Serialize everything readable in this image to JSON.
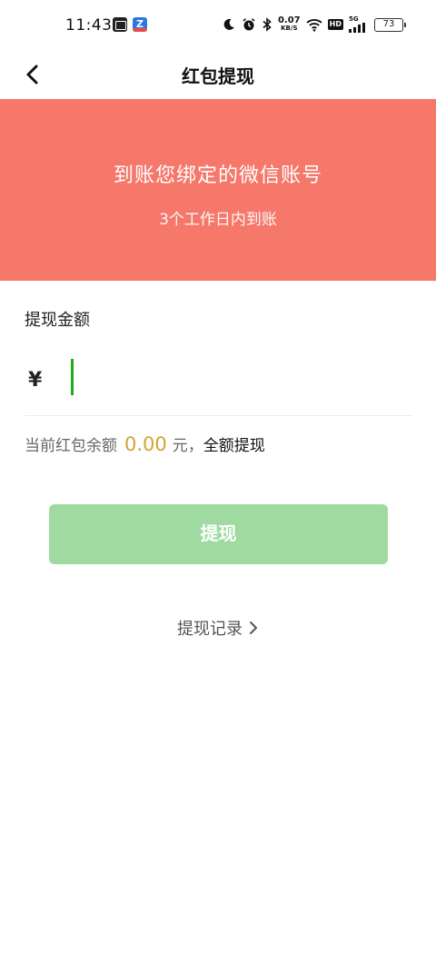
{
  "status_bar": {
    "time": "11:43",
    "app_icon_b_letter": "Z",
    "net_speed_value": "0.07",
    "net_speed_unit": "KB/S",
    "hd_label": "HD",
    "signal_label": "5G",
    "battery_level": "73",
    "icons": [
      "moon-icon",
      "alarm-icon",
      "bluetooth-icon",
      "wifi-icon",
      "signal-icon",
      "battery-icon"
    ]
  },
  "nav": {
    "title": "红包提现",
    "back_icon": "chevron-left-icon"
  },
  "banner": {
    "title": "到账您绑定的微信账号",
    "subtitle": "3个工作日内到账",
    "color": "#f5786b"
  },
  "amount": {
    "label": "提现金额",
    "currency_symbol": "¥",
    "input_value": "",
    "input_placeholder": ""
  },
  "balance": {
    "prefix": "当前红包余额",
    "value": "0.00",
    "unit": "元，",
    "withdraw_all_label": "全额提现",
    "value_color": "#d4a334"
  },
  "withdraw_button": {
    "label": "提现",
    "color": "#9fdaa1"
  },
  "records_link": {
    "label": "提现记录",
    "icon": "chevron-right-icon"
  }
}
